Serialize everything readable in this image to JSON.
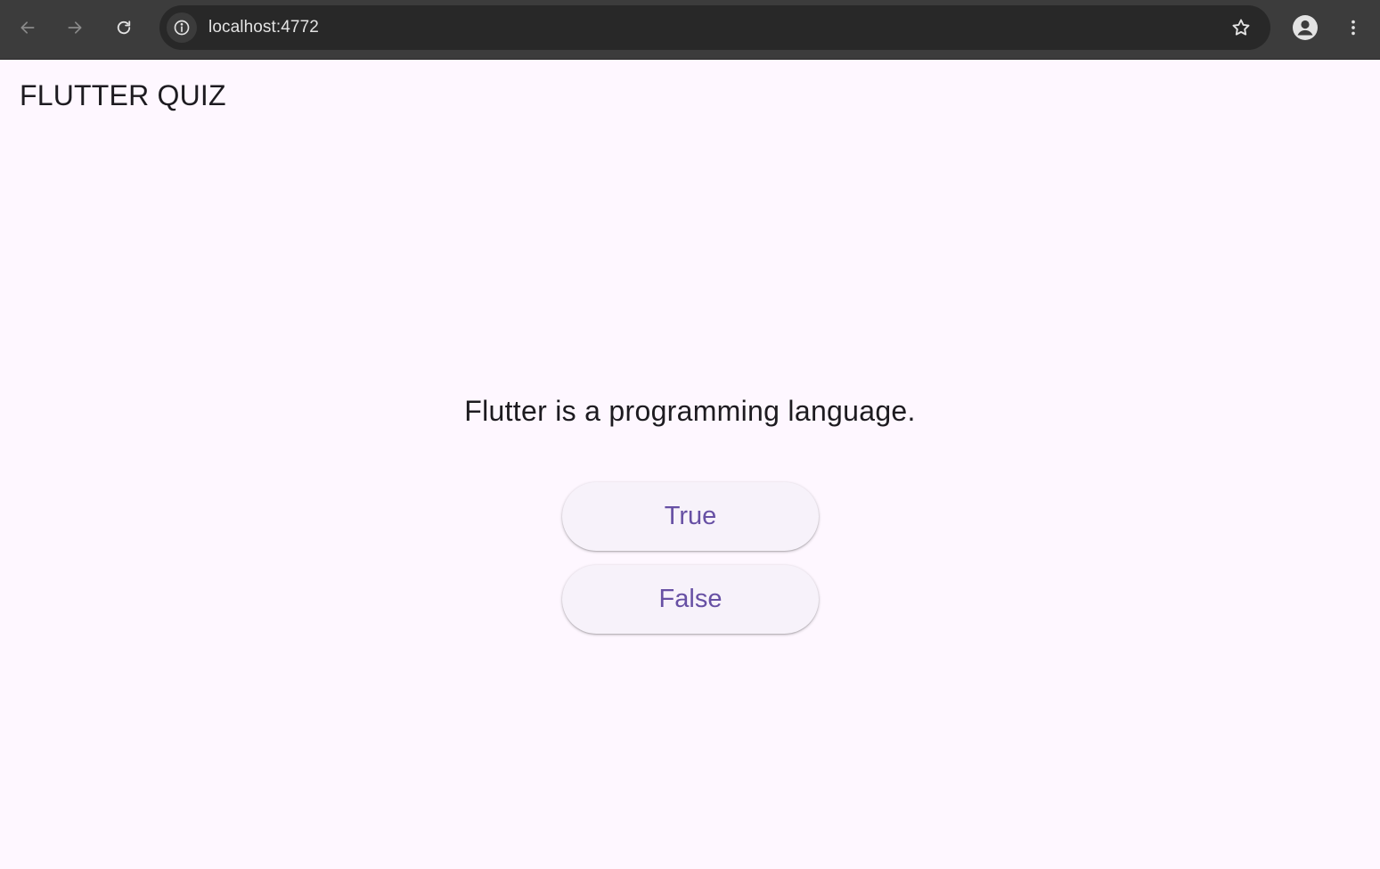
{
  "browser": {
    "url": "localhost:4772",
    "icons": {
      "back": "arrow-left-icon",
      "forward": "arrow-right-icon",
      "reload": "reload-icon",
      "site_info": "info-icon",
      "bookmark": "star-icon",
      "profile": "profile-icon",
      "menu": "kebab-menu-icon"
    }
  },
  "app": {
    "title": "FLUTTER QUIZ",
    "question": "Flutter is a programming language.",
    "answers": {
      "true_label": "True",
      "false_label": "False"
    }
  },
  "colors": {
    "chrome_background": "#3c3c3c",
    "omnibox_background": "#282828",
    "app_background": "#fef7ff",
    "text_primary": "#1d1b20",
    "button_background": "#f7f2fa",
    "button_text": "#6750a4"
  }
}
